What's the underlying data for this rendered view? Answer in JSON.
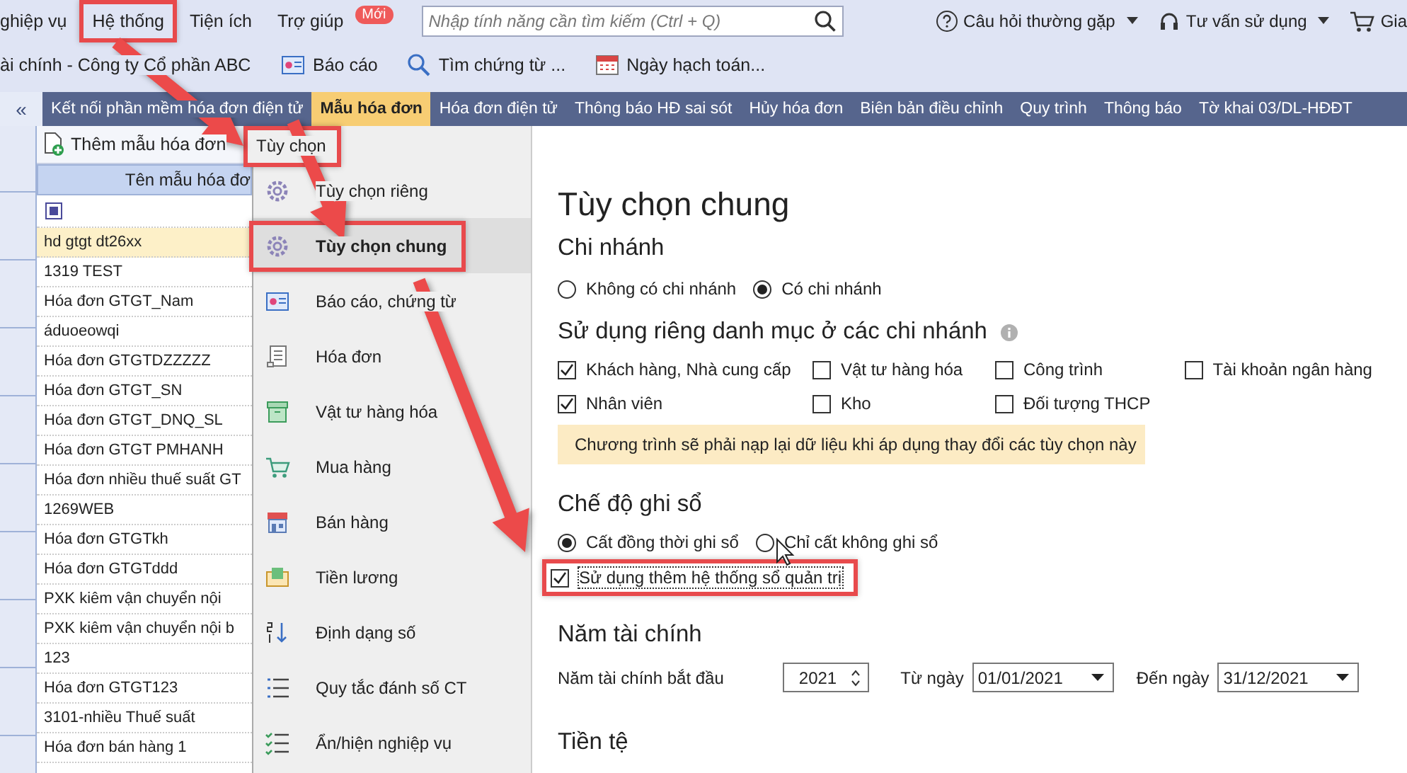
{
  "menubar": {
    "items": [
      {
        "label": "ghiệp vụ",
        "highlighted": false
      },
      {
        "label": "Hệ thống",
        "highlighted": true
      },
      {
        "label": "Tiện ích",
        "highlighted": false
      },
      {
        "label": "Trợ giúp",
        "highlighted": false,
        "badge": "Mới"
      }
    ],
    "search": {
      "placeholder": "Nhập tính năng cần tìm kiếm (Ctrl + Q)"
    },
    "links": [
      {
        "label": "Câu hỏi thường gặp"
      },
      {
        "label": "Tư vấn sử dụng"
      },
      {
        "label": "Gia"
      }
    ]
  },
  "toolbar": {
    "company": "ài chính - Công ty Cổ phần ABC",
    "buttons": [
      "Báo cáo",
      "Tìm chứng từ ...",
      "Ngày hạch toán..."
    ]
  },
  "collapse": "«",
  "tabs": [
    {
      "label": "Kết nối phần mềm hóa đơn điện tử",
      "selected": false
    },
    {
      "label": "Mẫu hóa đơn",
      "selected": true
    },
    {
      "label": "Hóa đơn điện tử",
      "selected": false
    },
    {
      "label": "Thông báo HĐ sai sót",
      "selected": false
    },
    {
      "label": "Hủy hóa đơn",
      "selected": false
    },
    {
      "label": "Biên bản điều chỉnh",
      "selected": false
    },
    {
      "label": "Quy trình",
      "selected": false
    },
    {
      "label": "Thông báo",
      "selected": false
    },
    {
      "label": "Tờ khai 03/DL-HĐĐT",
      "selected": false
    }
  ],
  "list": {
    "add_button": "Thêm mẫu hóa đơn",
    "column": "Tên mẫu hóa đơ",
    "rows": [
      {
        "name": "hd gtgt dt26xx",
        "selected": true
      },
      {
        "name": "1319 TEST",
        "selected": false
      },
      {
        "name": "Hóa đơn GTGT_Nam",
        "selected": false
      },
      {
        "name": "áduoeowqi",
        "selected": false
      },
      {
        "name": "Hóa đơn GTGTDZZZZZ",
        "selected": false
      },
      {
        "name": "Hóa đơn GTGT_SN",
        "selected": false
      },
      {
        "name": "Hóa đơn GTGT_DNQ_SL",
        "selected": false
      },
      {
        "name": "Hóa đơn GTGT PMHANH",
        "selected": false
      },
      {
        "name": "Hóa đơn nhiều thuế suất GT",
        "selected": false
      },
      {
        "name": "1269WEB",
        "selected": false
      },
      {
        "name": "Hóa đơn GTGTkh",
        "selected": false
      },
      {
        "name": "Hóa đơn GTGTddd",
        "selected": false
      },
      {
        "name": "PXK kiêm vận chuyển nội",
        "selected": false
      },
      {
        "name": "PXK kiêm vận chuyển nội b",
        "selected": false
      },
      {
        "name": "123",
        "selected": false
      },
      {
        "name": "Hóa đơn GTGT123",
        "selected": false
      },
      {
        "name": "3101-nhiều Thuế suất",
        "selected": false
      },
      {
        "name": "Hóa đơn bán hàng 1",
        "selected": false
      }
    ]
  },
  "menu": {
    "title": "Tùy chọn",
    "title_highlighted": true,
    "items": [
      {
        "label": "Tùy chọn riêng",
        "selected": false,
        "highlighted": false
      },
      {
        "label": "Tùy chọn chung",
        "selected": true,
        "highlighted": true
      },
      {
        "label": "Báo cáo, chứng từ",
        "selected": false,
        "highlighted": false
      },
      {
        "label": "Hóa đơn",
        "selected": false,
        "highlighted": false
      },
      {
        "label": "Vật tư hàng hóa",
        "selected": false,
        "highlighted": false
      },
      {
        "label": "Mua hàng",
        "selected": false,
        "highlighted": false
      },
      {
        "label": "Bán hàng",
        "selected": false,
        "highlighted": false
      },
      {
        "label": "Tiền lương",
        "selected": false,
        "highlighted": false
      },
      {
        "label": "Định dạng số",
        "selected": false,
        "highlighted": false
      },
      {
        "label": "Quy tắc đánh số CT",
        "selected": false,
        "highlighted": false
      },
      {
        "label": "Ẩn/hiện nghiệp vụ",
        "selected": false,
        "highlighted": false
      }
    ]
  },
  "content": {
    "title": "Tùy chọn chung",
    "branch": {
      "heading": "Chi nhánh",
      "options": [
        {
          "label": "Không có chi nhánh",
          "selected": false
        },
        {
          "label": "Có chi nhánh",
          "selected": true
        }
      ]
    },
    "separate": {
      "heading": "Sử dụng riêng danh mục ở các chi nhánh",
      "items": [
        {
          "label": "Khách hàng, Nhà cung cấp",
          "checked": true
        },
        {
          "label": "Vật tư hàng hóa",
          "checked": false
        },
        {
          "label": "Công trình",
          "checked": false
        },
        {
          "label": "Tài khoản ngân hàng",
          "checked": false
        },
        {
          "label": "Nhân viên",
          "checked": true
        },
        {
          "label": "Kho",
          "checked": false
        },
        {
          "label": "Đối tượng THCP",
          "checked": false
        }
      ]
    },
    "warning": "Chương trình sẽ phải nạp lại dữ liệu khi áp dụng thay đổi các tùy chọn này",
    "posting": {
      "heading": "Chế độ ghi sổ",
      "options": [
        {
          "label": "Cất đồng thời ghi sổ",
          "selected": true
        },
        {
          "label": "Chỉ cất không ghi sổ",
          "selected": false
        }
      ],
      "extra": {
        "label": "Sử dụng thêm hệ thống sổ quản trị",
        "checked": true,
        "highlighted": true
      }
    },
    "fiscal": {
      "heading": "Năm tài chính",
      "start_label": "Năm tài chính bắt đầu",
      "year": "2021",
      "from_label": "Từ ngày",
      "from": "01/01/2021",
      "to_label": "Đến ngày",
      "to": "31/12/2021"
    },
    "currency": {
      "heading": "Tiền tệ"
    }
  }
}
